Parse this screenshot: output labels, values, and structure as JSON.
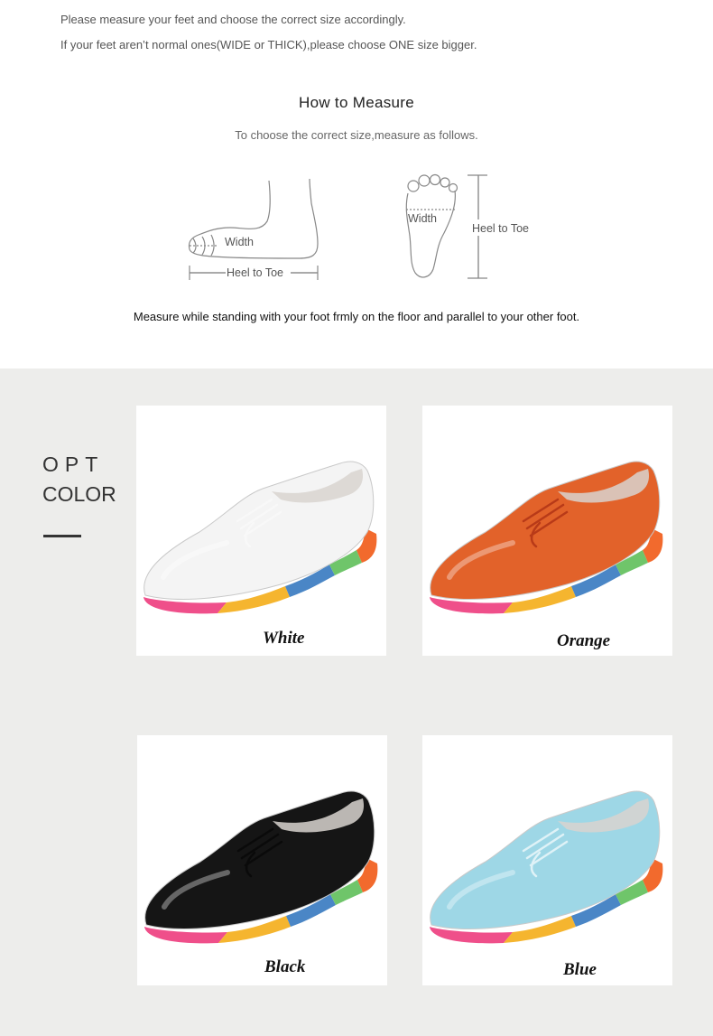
{
  "notes": {
    "line1": "Please measure your feet and choose the correct size accordingly.",
    "line2": "If your feet aren’t normal ones(WIDE or THICK),please choose ONE size bigger."
  },
  "measure": {
    "title": "How to Measure",
    "subtitle": "To choose the correct size,measure as follows.",
    "side_view": {
      "width_label": "Width",
      "length_label": "Heel to Toe"
    },
    "top_view": {
      "width_label": "Width",
      "length_label": "Heel to Toe"
    },
    "instruction": "Measure while standing with your foot frmly on the floor and parallel to your other foot."
  },
  "color_section": {
    "label_line1": "OPT",
    "label_line2": "COLOR",
    "options": [
      {
        "name": "White",
        "upper_color": "#f4f4f4",
        "lace_color": "#f8f8f8"
      },
      {
        "name": "Orange",
        "upper_color": "#e2622a",
        "lace_color": "#b83a18"
      },
      {
        "name": "Black",
        "upper_color": "#151515",
        "lace_color": "#0a0a0a"
      },
      {
        "name": "Blue",
        "upper_color": "#9ed7e6",
        "lace_color": "#dff2f7"
      }
    ],
    "sole_colors": [
      "#ef4f8a",
      "#f5b52f",
      "#4a86c6",
      "#6fc56a",
      "#f26a2d"
    ]
  }
}
